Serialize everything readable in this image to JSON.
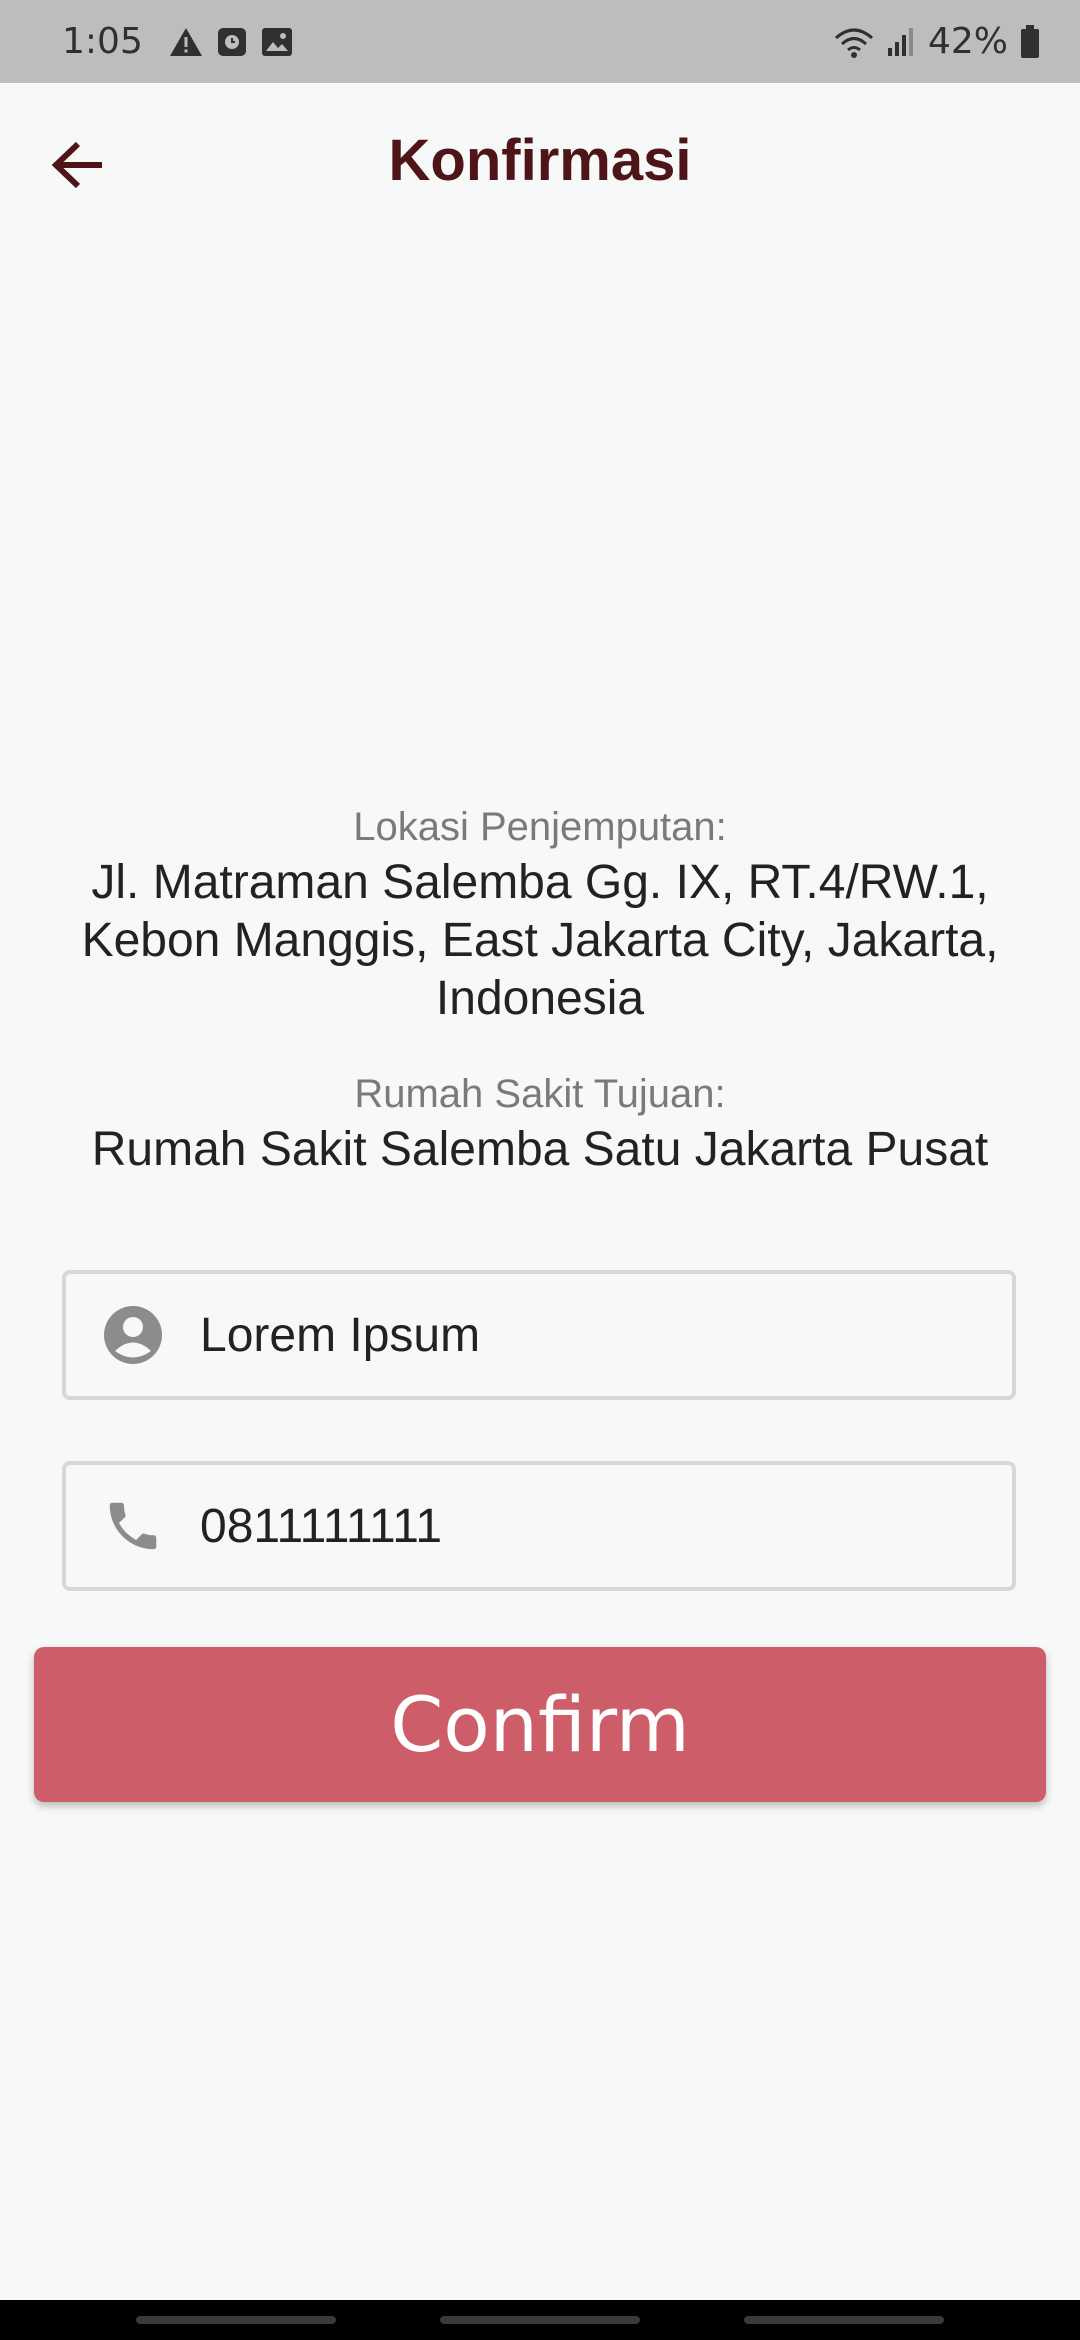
{
  "status_bar": {
    "time": "1:05",
    "battery_percent": "42%",
    "icons_left": [
      "warning-icon",
      "clock-app-icon",
      "image-icon"
    ],
    "icons_right": [
      "wifi-icon",
      "signal-icon",
      "battery-icon"
    ]
  },
  "header": {
    "title": "Konfirmasi",
    "back_icon": "arrow-back-icon"
  },
  "pickup": {
    "label": "Lokasi Penjemputan:",
    "address_line1": "Jl. Matraman Salemba Gg. IX, RT.4/RW.1,",
    "address_line2": "Kebon Manggis, East Jakarta City, Jakarta,",
    "address_line3": "Indonesia"
  },
  "destination": {
    "label": "Rumah Sakit Tujuan:",
    "value": "Rumah Sakit Salemba Satu Jakarta Pusat"
  },
  "form": {
    "name_value": "Lorem Ipsum",
    "name_icon": "person-icon",
    "phone_value": "0811111111",
    "phone_icon": "phone-icon"
  },
  "confirm_label": "Confirm",
  "colors": {
    "title": "#4e1418",
    "button": "#cd5e69",
    "status_bar": "#bdbdbd",
    "background": "#f7f9f8"
  }
}
